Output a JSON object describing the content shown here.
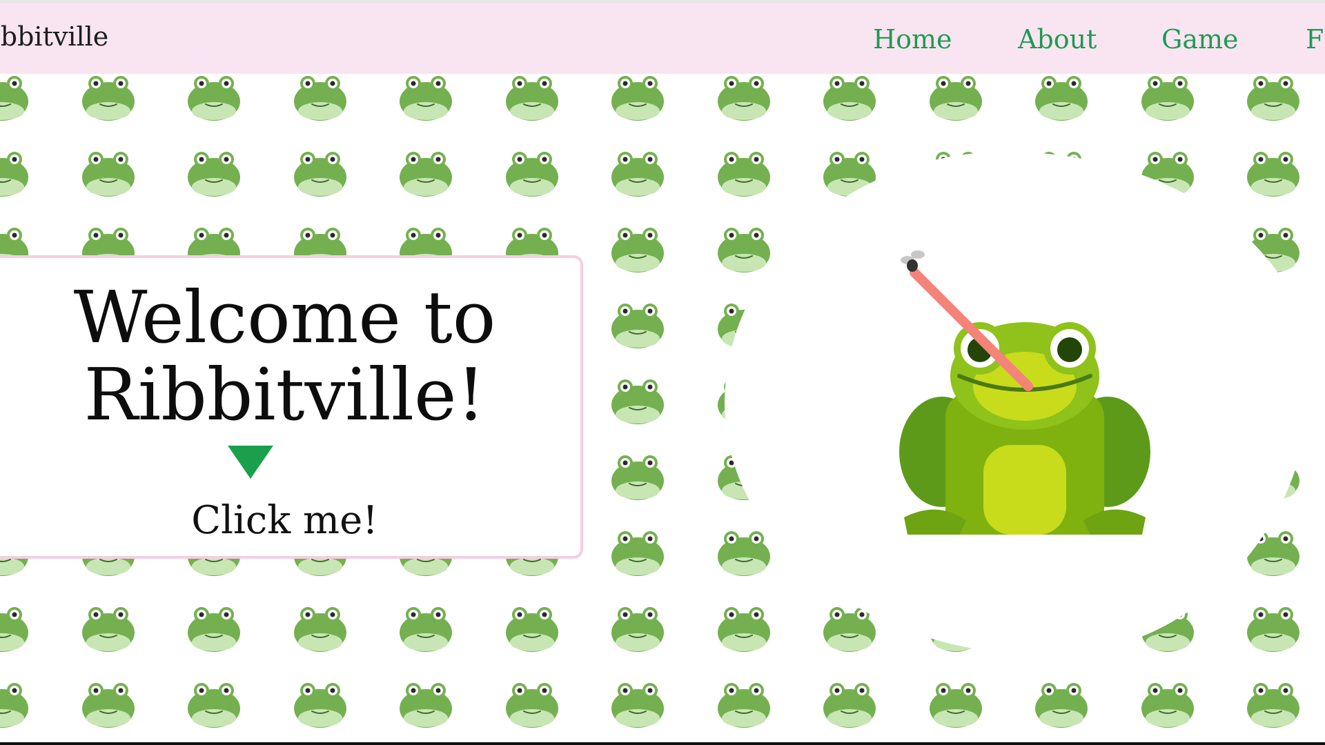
{
  "app": {
    "brand": "Ribbitville"
  },
  "nav": {
    "items": [
      {
        "label": "Home"
      },
      {
        "label": "About"
      },
      {
        "label": "Game"
      },
      {
        "label": "Fr"
      }
    ]
  },
  "hero": {
    "title_line1": "Welcome to",
    "title_line2": "Ribbitville!",
    "cta_label": "Click me!",
    "arrow_icon": "triangle-down-icon",
    "frog_icon": "frog-catching-fly-icon"
  },
  "background": {
    "pattern_icon": "frog-face-icon"
  },
  "colors": {
    "nav_bg": "#f8e5f1",
    "nav_link": "#1f9a52",
    "card_border": "#f7cde3",
    "arrow": "#1aa04d",
    "frog_green": "#74b050",
    "frog_belly": "#c8e6b4"
  }
}
